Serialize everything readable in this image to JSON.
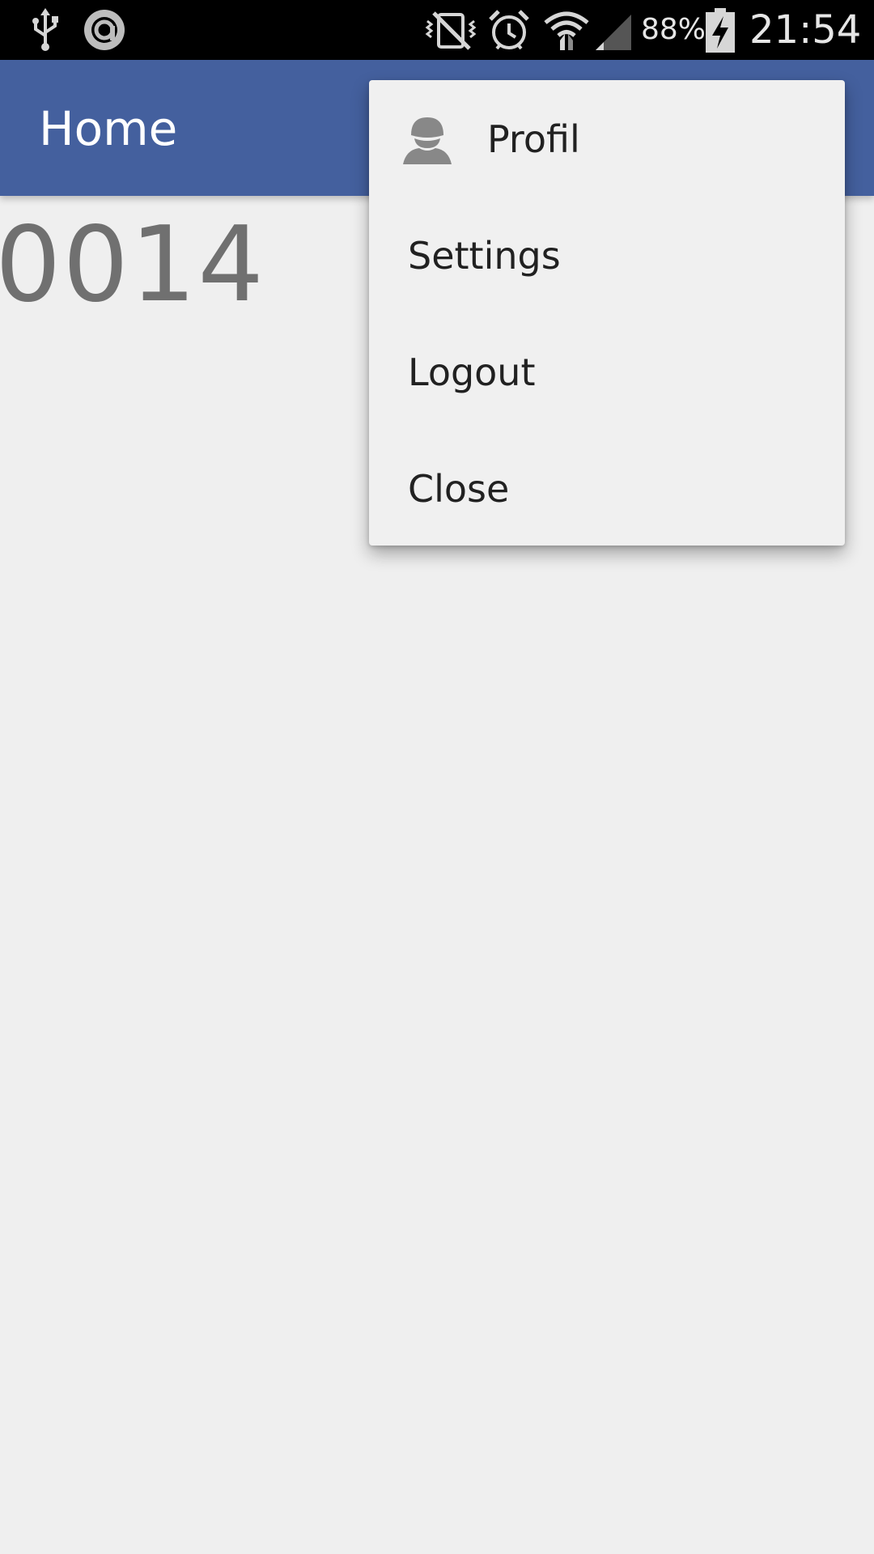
{
  "status_bar": {
    "left_icons": [
      "usb-icon",
      "app-notification-icon"
    ],
    "right_icons": [
      "vibrate-mute-icon",
      "alarm-icon",
      "wifi-icon",
      "cell-signal-icon",
      "battery-charging-icon"
    ],
    "battery_percent": "88%",
    "time": "21:54"
  },
  "app_bar": {
    "title": "Home",
    "color": "#44609e"
  },
  "content": {
    "counter": "0014"
  },
  "menu": {
    "items": [
      {
        "label": "Profil",
        "icon": "person-icon"
      },
      {
        "label": "Settings"
      },
      {
        "label": "Logout"
      },
      {
        "label": "Close"
      }
    ]
  }
}
